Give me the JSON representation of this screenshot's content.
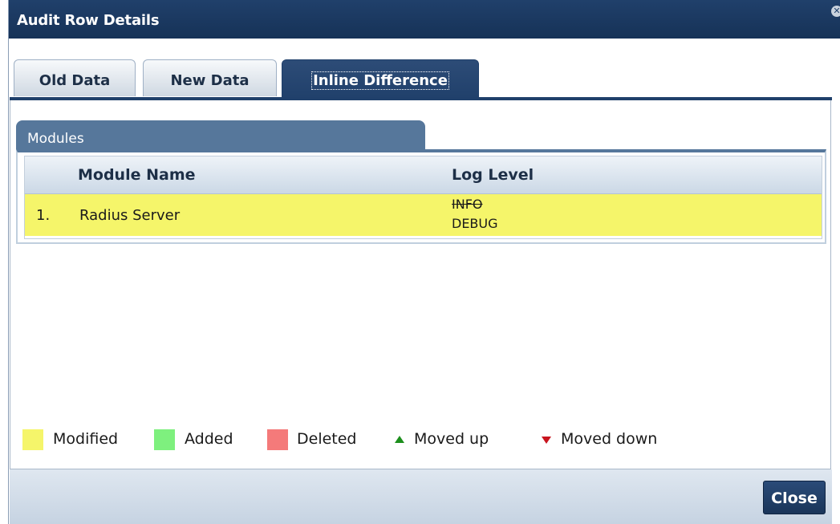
{
  "dialog": {
    "title": "Audit Row Details"
  },
  "tabs": [
    {
      "label": "Old Data",
      "active": false
    },
    {
      "label": "New Data",
      "active": false
    },
    {
      "label": "Inline Difference",
      "active": true
    }
  ],
  "section": {
    "title": "Modules"
  },
  "table": {
    "columns": [
      "Module Name",
      "Log Level"
    ],
    "rows": [
      {
        "index": "1.",
        "module_name": "Radius Server",
        "log_level_old": "INFO",
        "log_level_new": "DEBUG",
        "status": "Modified"
      }
    ]
  },
  "legend": {
    "modified": {
      "label": "Modified",
      "color": "#f5f56a"
    },
    "added": {
      "label": "Added",
      "color": "#7ef07e"
    },
    "deleted": {
      "label": "Deleted",
      "color": "#f47a7a"
    },
    "moved_up": {
      "label": "Moved up",
      "color": "#1d8f1d"
    },
    "moved_down": {
      "label": "Moved down",
      "color": "#c8141e"
    }
  },
  "footer": {
    "close_label": "Close"
  },
  "colors": {
    "titlebar": "#20406b",
    "section_header": "#56779b"
  }
}
